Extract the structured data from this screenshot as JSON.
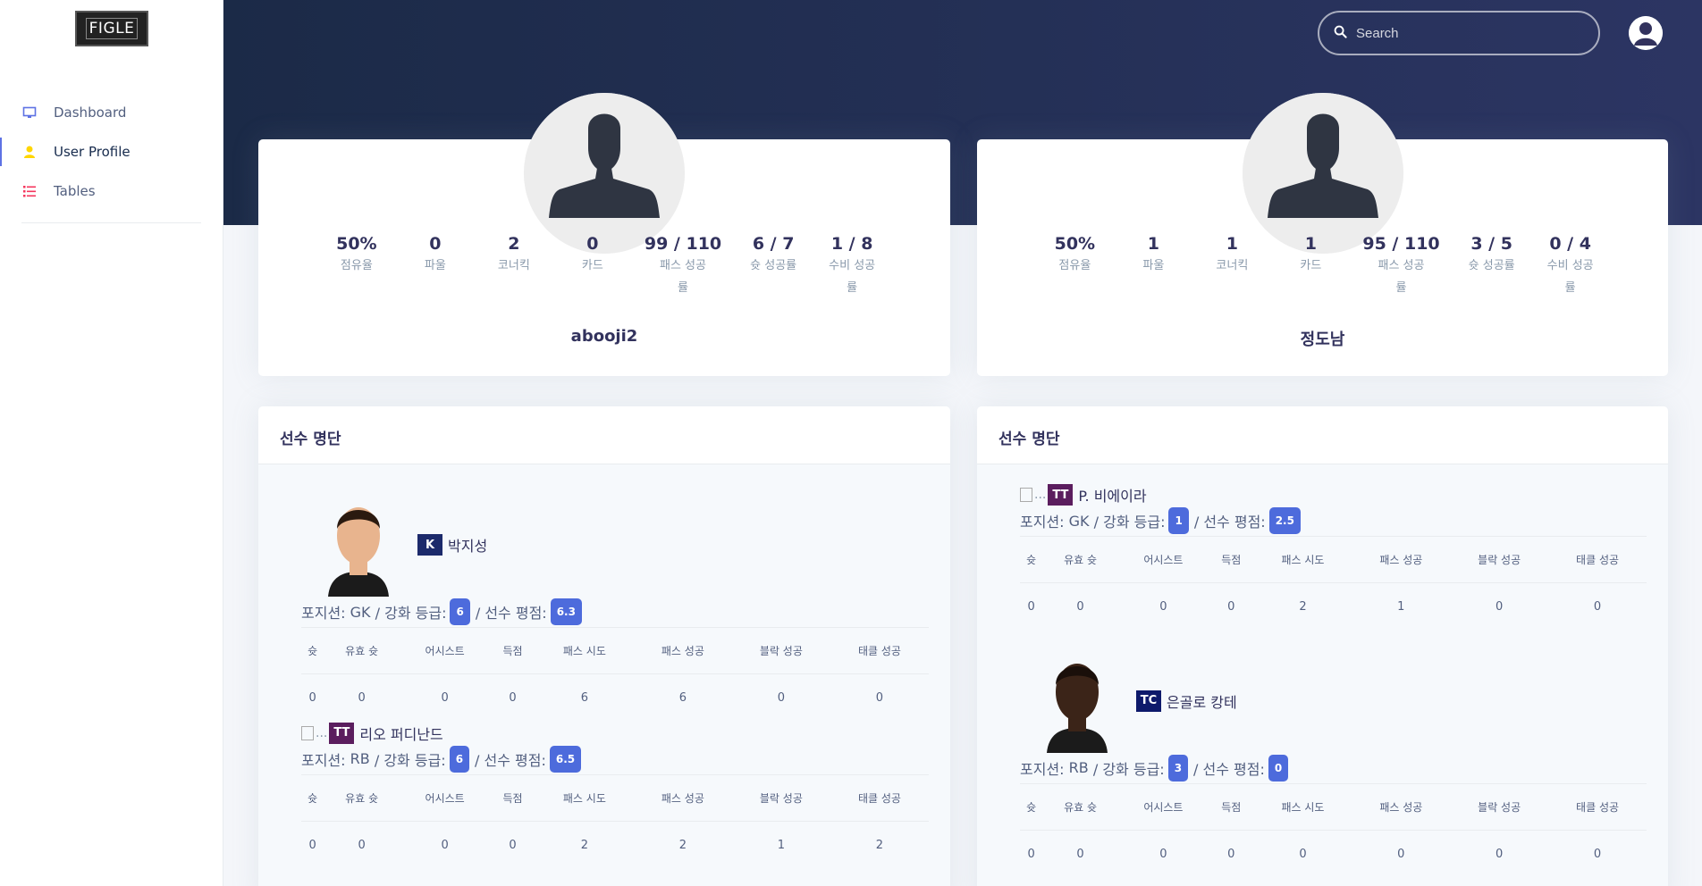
{
  "brand": {
    "logo_text": "FIGLE"
  },
  "sidebar": {
    "items": [
      {
        "label": "Dashboard",
        "icon": "monitor-icon",
        "color": "#5e72e4"
      },
      {
        "label": "User Profile",
        "icon": "user-icon",
        "color": "#ffd600"
      },
      {
        "label": "Tables",
        "icon": "list-icon",
        "color": "#f5365c"
      }
    ]
  },
  "header": {
    "search_placeholder": "Search",
    "avatar": "user-avatar-icon"
  },
  "profiles": [
    {
      "name": "abooji2",
      "stats": [
        {
          "value": "50%",
          "label": "점유율"
        },
        {
          "value": "0",
          "label": "파울"
        },
        {
          "value": "2",
          "label": "코너킥"
        },
        {
          "value": "0",
          "label": "카드"
        },
        {
          "value": "99 / 110",
          "label": "패스 성공률"
        },
        {
          "value": "6 / 7",
          "label": "슛 성공률"
        },
        {
          "value": "1 / 8",
          "label": "수비 성공률"
        }
      ]
    },
    {
      "name": "정도남",
      "stats": [
        {
          "value": "50%",
          "label": "점유율"
        },
        {
          "value": "1",
          "label": "파울"
        },
        {
          "value": "1",
          "label": "코너킥"
        },
        {
          "value": "1",
          "label": "카드"
        },
        {
          "value": "95 / 110",
          "label": "패스 성공률"
        },
        {
          "value": "3 / 5",
          "label": "슛 성공률"
        },
        {
          "value": "0 / 4",
          "label": "수비 성공률"
        }
      ]
    }
  ],
  "roster_title": "선수 명단",
  "table_headers": [
    "슛",
    "유효 슛",
    "어시스트",
    "득점",
    "패스 시도",
    "패스 성공",
    "블락 성공",
    "태클 성공"
  ],
  "meta_labels": {
    "position_prefix": "포지션:",
    "grade_label": "/ 강화 등급:",
    "rating_label": "/ 선수 평점:",
    "broken_img": "..."
  },
  "rosters": [
    [
      {
        "name": "박지성",
        "season": "K",
        "season_bg": "#1c2a6b",
        "season_fg": "#ffffff",
        "has_face": true,
        "position": "GK",
        "grade": "6",
        "rating": "6.3",
        "values": [
          "0",
          "0",
          "0",
          "0",
          "6",
          "6",
          "0",
          "0"
        ]
      },
      {
        "name": "리오 퍼디난드",
        "season": "TT",
        "season_bg": "#5b1d5e",
        "season_fg": "#ffffff",
        "has_face": false,
        "position": "RB",
        "grade": "6",
        "rating": "6.5",
        "values": [
          "0",
          "0",
          "0",
          "0",
          "2",
          "2",
          "1",
          "2"
        ]
      }
    ],
    [
      {
        "name": "P. 비에이라",
        "season": "TT",
        "season_bg": "#5b1d5e",
        "season_fg": "#ffffff",
        "has_face": false,
        "position": "GK",
        "grade": "1",
        "rating": "2.5",
        "values": [
          "0",
          "0",
          "0",
          "0",
          "2",
          "1",
          "0",
          "0"
        ]
      },
      {
        "name": "은골로 캉테",
        "season": "TC",
        "season_bg": "#0e1a6b",
        "season_fg": "#ffffff",
        "has_face": true,
        "position": "RB",
        "grade": "3",
        "rating": "0",
        "values": [
          "0",
          "0",
          "0",
          "0",
          "0",
          "0",
          "0",
          "0"
        ]
      }
    ]
  ]
}
